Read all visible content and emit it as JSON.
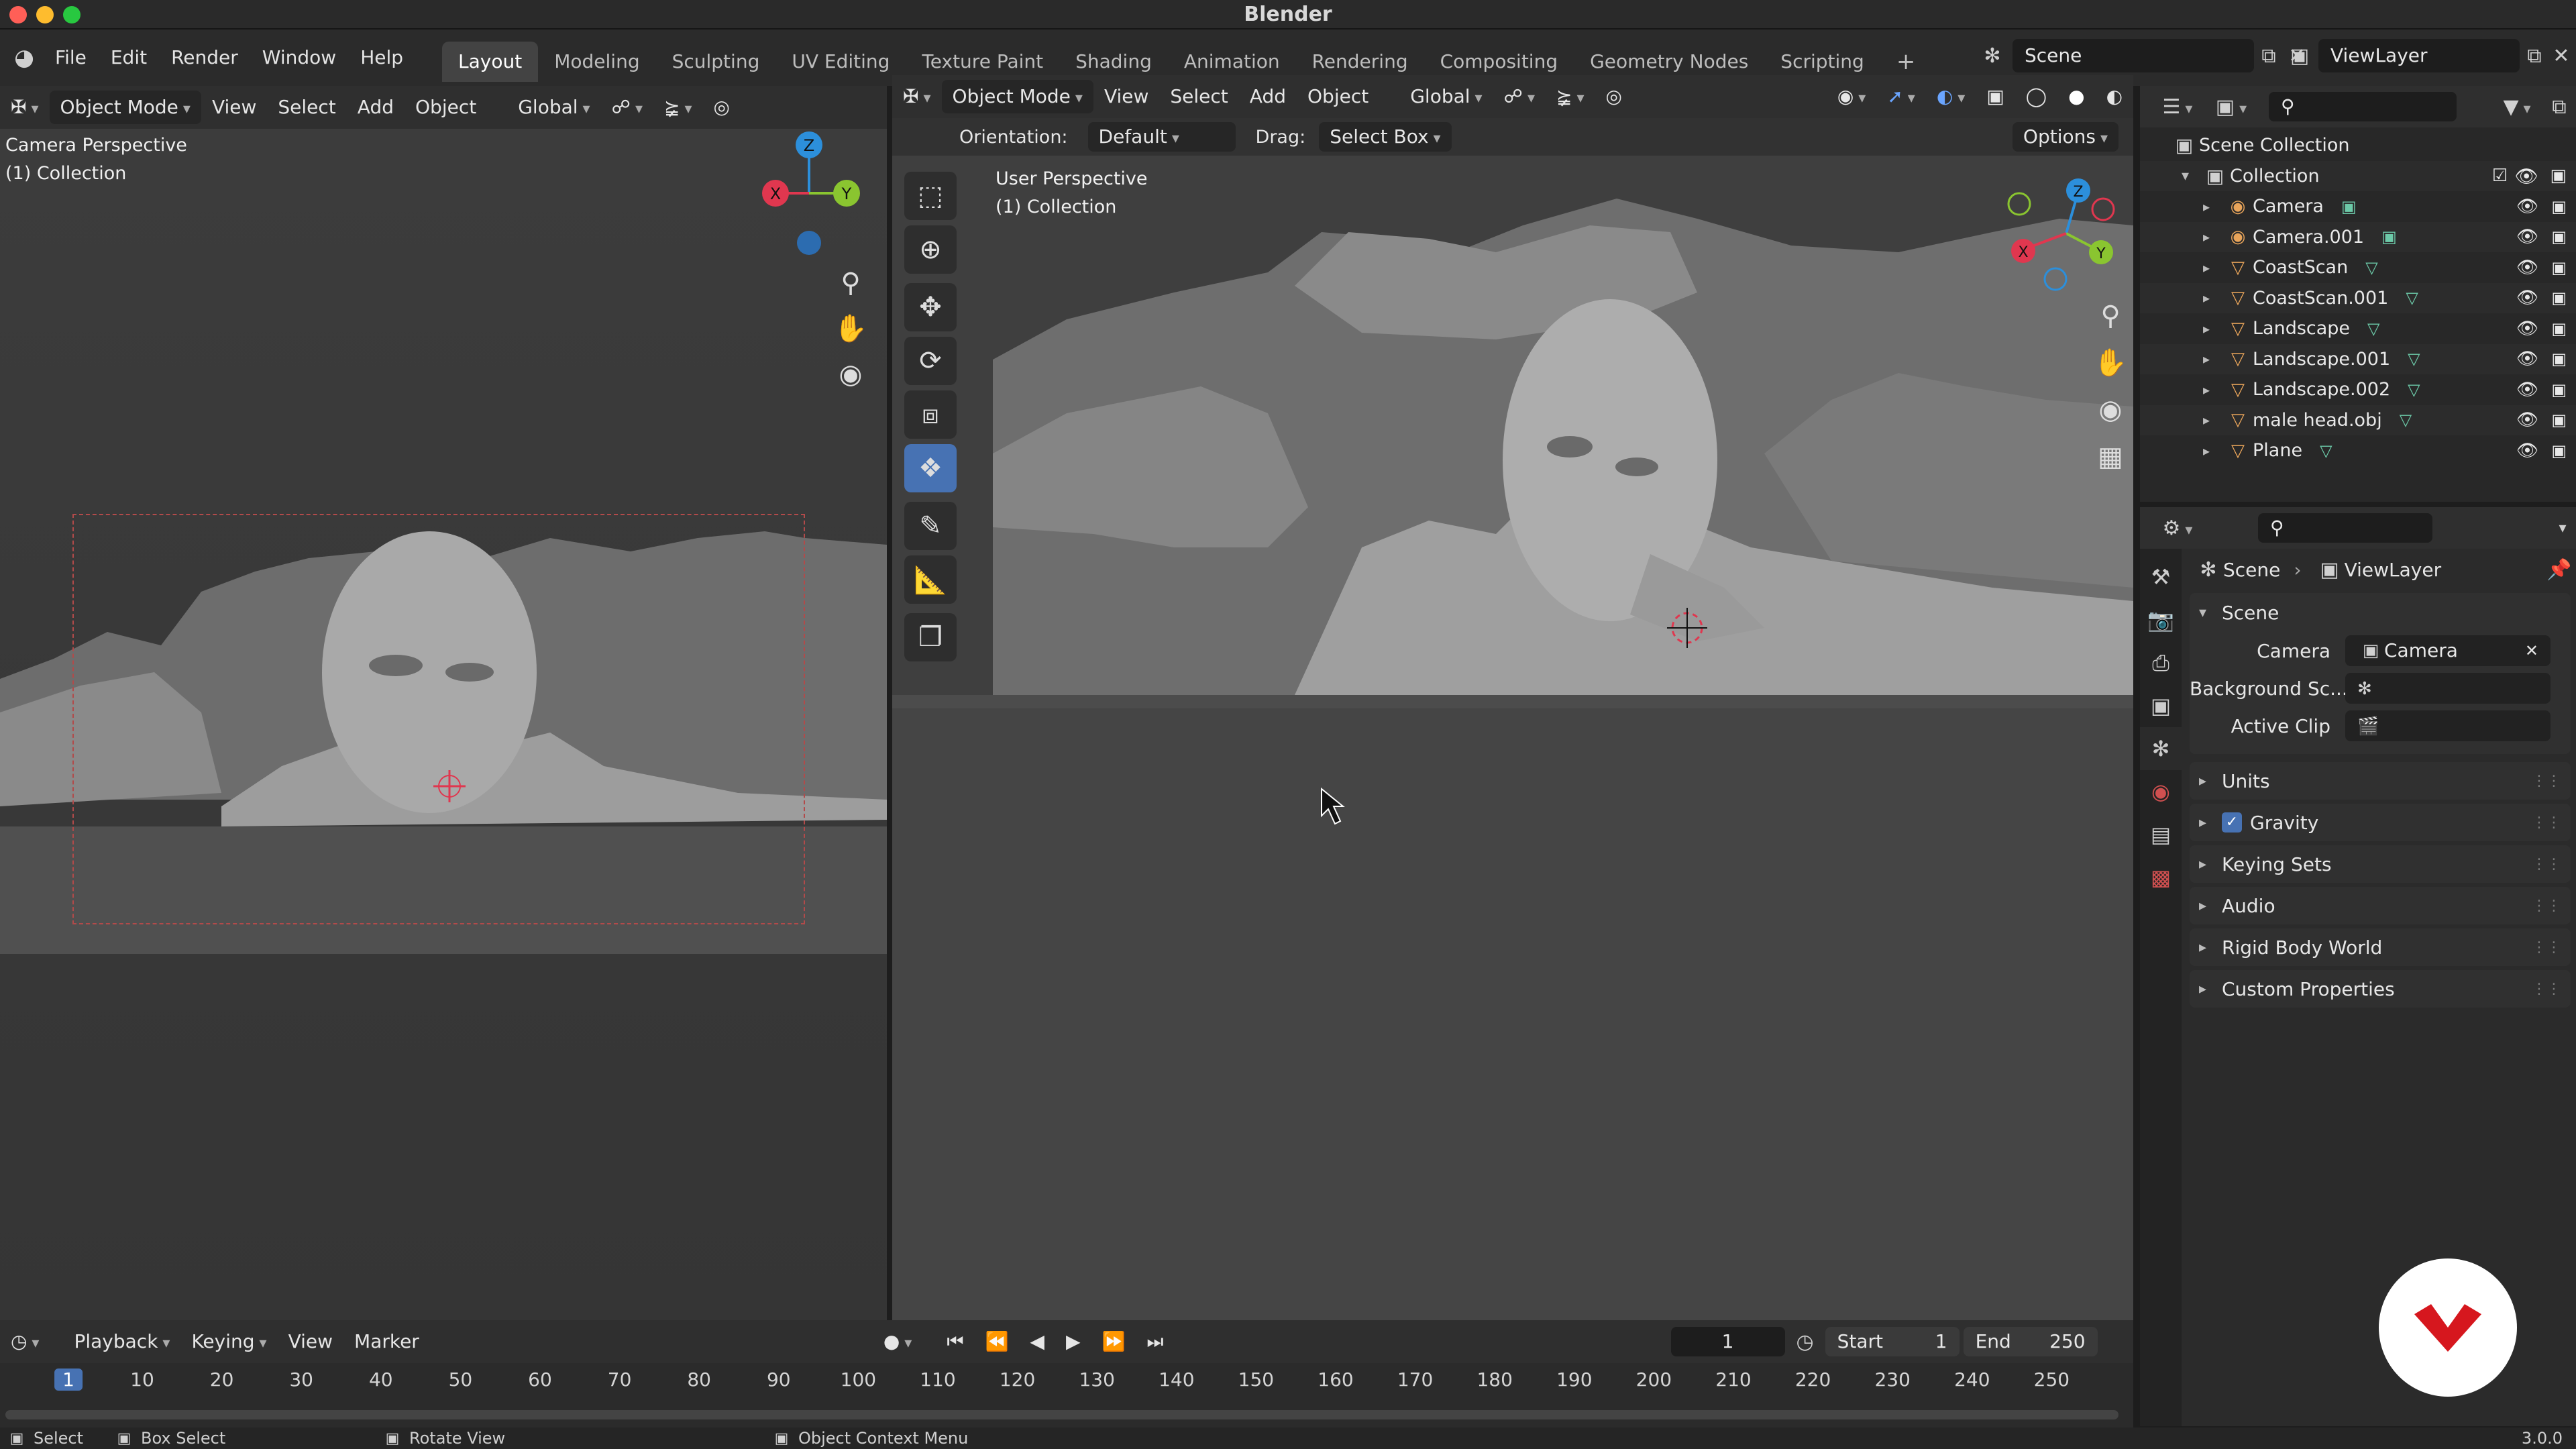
{
  "app": {
    "title": "Blender",
    "version": "3.0.0"
  },
  "menu": [
    "File",
    "Edit",
    "Render",
    "Window",
    "Help"
  ],
  "workspaces": [
    "Layout",
    "Modeling",
    "Sculpting",
    "UV Editing",
    "Texture Paint",
    "Shading",
    "Animation",
    "Rendering",
    "Compositing",
    "Geometry Nodes",
    "Scripting"
  ],
  "active_workspace": "Layout",
  "scene_selector": {
    "scene": "Scene",
    "view_layer": "ViewLayer"
  },
  "left_viewport": {
    "mode": "Object Mode",
    "menus": [
      "View",
      "Select",
      "Add",
      "Object"
    ],
    "orientation": "Global",
    "overlay_title": "Camera Perspective",
    "overlay_collection": "(1) Collection"
  },
  "right_viewport": {
    "mode": "Object Mode",
    "menus": [
      "View",
      "Select",
      "Add",
      "Object"
    ],
    "orientation": "Global",
    "tool_orientation_label": "Orientation:",
    "tool_orientation_value": "Default",
    "drag_label": "Drag:",
    "drag_value": "Select Box",
    "options": "Options",
    "overlay_title": "User Perspective",
    "overlay_collection": "(1) Collection"
  },
  "gizmo": {
    "x": "X",
    "y": "Y",
    "z": "Z"
  },
  "outliner": {
    "root": "Scene Collection",
    "collection": "Collection",
    "items": [
      "Camera",
      "Camera.001",
      "CoastScan",
      "CoastScan.001",
      "Landscape",
      "Landscape.001",
      "Landscape.002",
      "male head.obj",
      "Plane"
    ]
  },
  "properties": {
    "breadcrumb_scene": "Scene",
    "breadcrumb_viewlayer": "ViewLayer",
    "section_scene": "Scene",
    "camera_label": "Camera",
    "camera_value": "Camera",
    "background_label": "Background Sc...",
    "active_clip_label": "Active Clip",
    "panels": [
      "Units",
      "Gravity",
      "Keying Sets",
      "Audio",
      "Rigid Body World",
      "Custom Properties"
    ]
  },
  "timeline": {
    "menus": [
      "Playback",
      "Keying",
      "View",
      "Marker"
    ],
    "current_frame": "1",
    "start_label": "Start",
    "start_value": "1",
    "end_label": "End",
    "end_value": "250",
    "ticks": [
      "1",
      "10",
      "20",
      "30",
      "40",
      "50",
      "60",
      "70",
      "80",
      "90",
      "100",
      "110",
      "120",
      "130",
      "140",
      "150",
      "160",
      "170",
      "180",
      "190",
      "200",
      "210",
      "220",
      "230",
      "240",
      "250"
    ]
  },
  "statusbar": {
    "select": "Select",
    "box_select": "Box Select",
    "rotate": "Rotate View",
    "context": "Object Context Menu"
  },
  "colors": {
    "accent": "#4772b3",
    "x_axis": "#e0374f",
    "y_axis": "#8ac530",
    "z_axis": "#2c8fdb",
    "logo": "#d6171e"
  }
}
